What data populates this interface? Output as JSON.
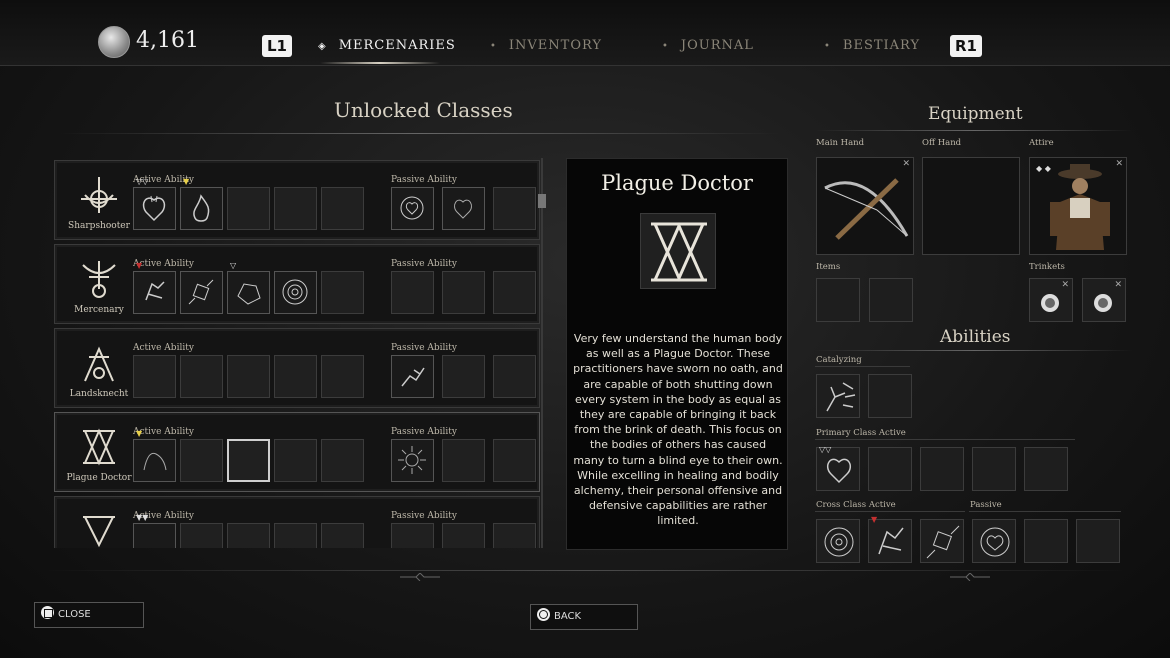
{
  "topbar": {
    "currency_value": "4,161",
    "left_bumper": "L1",
    "right_bumper": "R1",
    "tabs": [
      {
        "label": "MERCENARIES",
        "active": true
      },
      {
        "label": "INVENTORY",
        "active": false
      },
      {
        "label": "JOURNAL",
        "active": false
      },
      {
        "label": "BESTIARY",
        "active": false
      }
    ]
  },
  "classes_panel": {
    "title": "Unlocked Classes",
    "active_label": "Active Ability",
    "passive_label": "Passive Ability",
    "rows": [
      {
        "name": "Sharpshooter",
        "icon": "sharpshooter-sigil-icon"
      },
      {
        "name": "Mercenary",
        "icon": "mercenary-sigil-icon"
      },
      {
        "name": "Landsknecht",
        "icon": "landsknecht-sigil-icon"
      },
      {
        "name": "Plague Doctor",
        "icon": "plague-doctor-sigil-icon"
      },
      {
        "name": "",
        "icon": "unknown-class-sigil-icon"
      }
    ]
  },
  "detail": {
    "title": "Plague Doctor",
    "emblem": "plague-doctor-emblem-icon",
    "description": "Very few understand the human body as well as a Plague Doctor. These practitioners have sworn no oath, and are capable of both shutting down every system in the body as equal as they are capable of bringing it back from the brink of death. This focus on the bodies of others has caused many to turn a blind eye to their own. While excelling in healing and bodily alchemy, their personal offensive and defensive capabilities are rather limited."
  },
  "equipment": {
    "title": "Equipment",
    "main_hand_label": "Main Hand",
    "off_hand_label": "Off Hand",
    "attire_label": "Attire",
    "items_label": "Items",
    "trinkets_label": "Trinkets"
  },
  "abilities": {
    "title": "Abilities",
    "catalyzing_label": "Catalyzing",
    "primary_label": "Primary Class Active",
    "cross_label": "Cross Class Active",
    "passive_label": "Passive"
  },
  "footer": {
    "close_label": "CLOSE",
    "back_label": "BACK"
  },
  "colors": {
    "background": "#161616",
    "text": "#d8d2c4",
    "marker_yellow": "#e8d04a",
    "marker_red": "#c43030"
  }
}
